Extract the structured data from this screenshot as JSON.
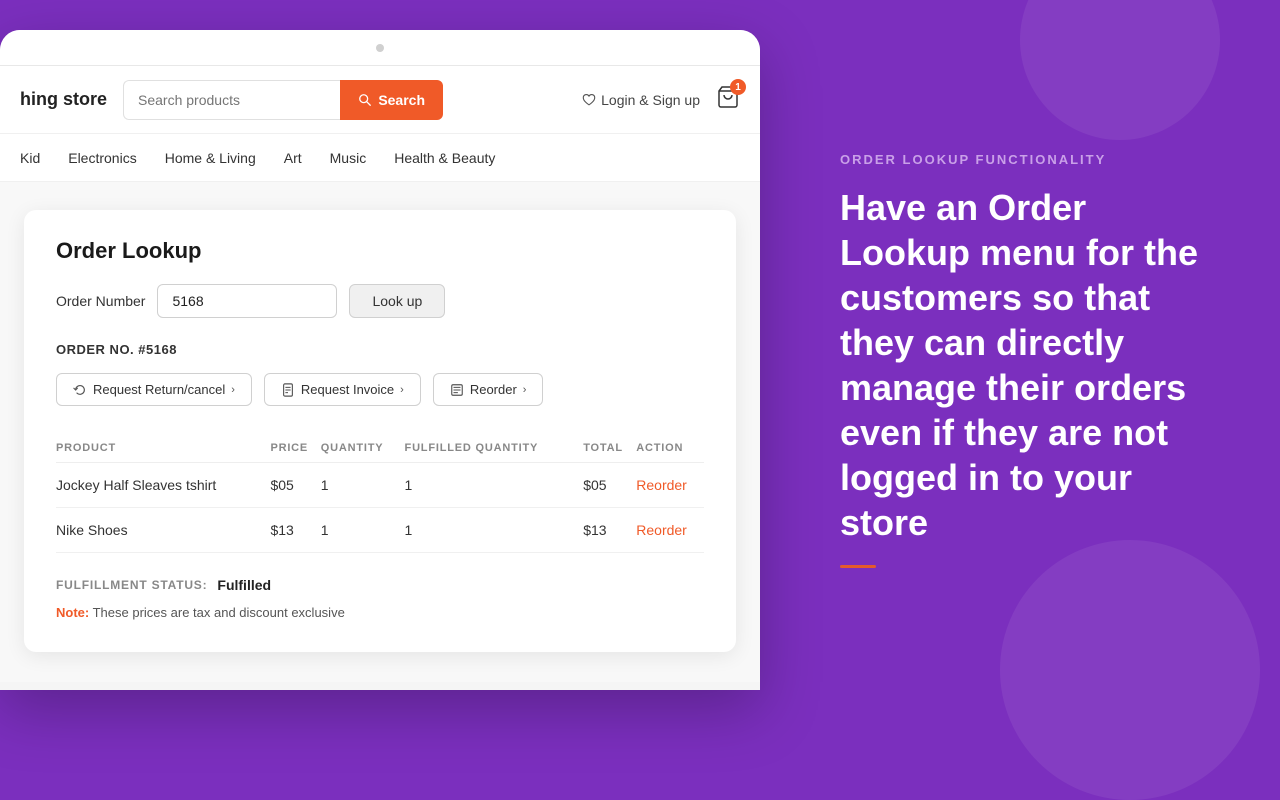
{
  "background_color": "#7b2fbe",
  "right_panel": {
    "section_label": "ORDER LOOKUP FUNCTIONALITY",
    "headline": "Have an Order Lookup menu for the customers so that they can directly manage their orders even if they are not logged in to your store"
  },
  "browser": {
    "dot": ""
  },
  "header": {
    "store_name": "hing store",
    "search_placeholder": "Search products",
    "search_button_label": "Search",
    "login_label": "Login & Sign up",
    "cart_badge": "1"
  },
  "nav": {
    "items": [
      {
        "label": "Kid"
      },
      {
        "label": "Electronics"
      },
      {
        "label": "Home & Living"
      },
      {
        "label": "Art"
      },
      {
        "label": "Music"
      },
      {
        "label": "Health & Beauty"
      }
    ]
  },
  "order_lookup": {
    "title": "Order Lookup",
    "order_number_label": "Order Number",
    "order_number_value": "5168",
    "lookup_button_label": "Look up",
    "order_ref": "ORDER NO. #5168",
    "buttons": [
      {
        "label": "Request Return/cancel"
      },
      {
        "label": "Request Invoice"
      },
      {
        "label": "Reorder"
      }
    ],
    "table": {
      "columns": [
        "PRODUCT",
        "PRICE",
        "QUANTITY",
        "FULFILLED QUANTITY",
        "TOTAL",
        "ACTION"
      ],
      "rows": [
        {
          "product": "Jockey Half Sleaves tshirt",
          "price": "$05",
          "quantity": "1",
          "fulfilled_quantity": "1",
          "total": "$05",
          "action": "Reorder"
        },
        {
          "product": "Nike Shoes",
          "price": "$13",
          "quantity": "1",
          "fulfilled_quantity": "1",
          "total": "$13",
          "action": "Reorder"
        }
      ]
    },
    "fulfillment_label": "FULFILLMENT STATUS:",
    "fulfillment_value": "Fulfilled",
    "note_label": "Note:",
    "note_text": "These prices are tax and discount exclusive"
  }
}
